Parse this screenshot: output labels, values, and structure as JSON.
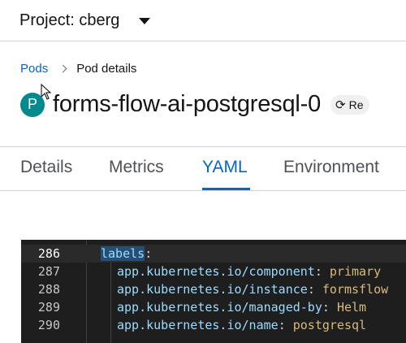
{
  "project": {
    "label": "Project: cberg"
  },
  "breadcrumb": {
    "root": "Pods",
    "current": "Pod details"
  },
  "pod": {
    "badge": "P",
    "name": "forms-flow-ai-postgresql-0",
    "refresh_label": "Re"
  },
  "tabs": [
    {
      "label": "Details"
    },
    {
      "label": "Metrics"
    },
    {
      "label": "YAML"
    },
    {
      "label": "Environment"
    }
  ],
  "editor": {
    "lines": [
      {
        "num": "286",
        "key": "labels",
        "sep": ":",
        "value": ""
      },
      {
        "num": "287",
        "key": "app.kubernetes.io/component",
        "sep": ": ",
        "value": "primary"
      },
      {
        "num": "288",
        "key": "app.kubernetes.io/instance",
        "sep": ": ",
        "value": "formsflow"
      },
      {
        "num": "289",
        "key": "app.kubernetes.io/managed-by",
        "sep": ": ",
        "value": "Helm"
      },
      {
        "num": "290",
        "key": "app.kubernetes.io/name",
        "sep": ": ",
        "value": "postgresql"
      }
    ]
  }
}
